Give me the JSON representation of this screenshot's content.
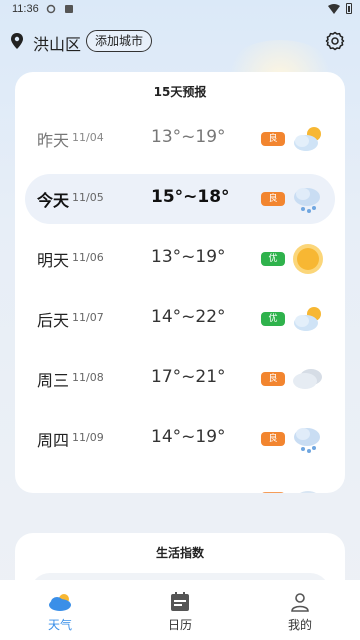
{
  "status_bar": {
    "time": "11:36"
  },
  "header": {
    "city": "洪山区",
    "add_city_label": "添加城市"
  },
  "forecast": {
    "title": "15天预报",
    "days": [
      {
        "day": "昨天",
        "date": "11/04",
        "temp": "13°~19°",
        "aqi": "良",
        "icon": "partly-cloudy-icon"
      },
      {
        "day": "今天",
        "date": "11/05",
        "temp": "15°~18°",
        "aqi": "良",
        "icon": "light-rain-icon"
      },
      {
        "day": "明天",
        "date": "11/06",
        "temp": "13°~19°",
        "aqi": "优",
        "icon": "sunny-icon"
      },
      {
        "day": "后天",
        "date": "11/07",
        "temp": "14°~22°",
        "aqi": "优",
        "icon": "partly-cloudy-icon"
      },
      {
        "day": "周三",
        "date": "11/08",
        "temp": "17°~21°",
        "aqi": "良",
        "icon": "overcast-icon"
      },
      {
        "day": "周四",
        "date": "11/09",
        "temp": "14°~19°",
        "aqi": "良",
        "icon": "light-rain-icon"
      }
    ]
  },
  "life_index": {
    "title": "生活指数"
  },
  "tabbar": {
    "tabs": [
      {
        "label": "天气",
        "icon": "weather-icon",
        "active": true
      },
      {
        "label": "日历",
        "icon": "calendar-icon",
        "active": false
      },
      {
        "label": "我的",
        "icon": "profile-icon",
        "active": false
      }
    ]
  },
  "colors": {
    "accent": "#3a8fe8",
    "aqi_good": "#f2852f",
    "aqi_excellent": "#2fb24c"
  }
}
